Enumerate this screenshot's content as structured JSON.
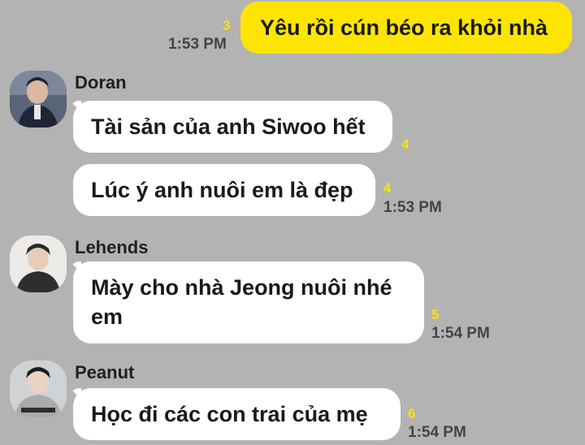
{
  "messages": {
    "me": {
      "text": "Yêu rồi cún béo ra khỏi nhà",
      "unread": "3",
      "time": "1:53 PM"
    },
    "doran": {
      "sender": "Doran",
      "bubble1": {
        "text": "Tài sản của anh Siwoo hết",
        "unread": "4"
      },
      "bubble2": {
        "text": "Lúc ý anh nuôi em là đẹp",
        "unread": "4",
        "time": "1:53 PM"
      }
    },
    "lehends": {
      "sender": "Lehends",
      "bubble1": {
        "line1": "Mày cho nhà Jeong nuôi nhé",
        "line2": "em",
        "unread": "5",
        "time": "1:54 PM"
      }
    },
    "peanut": {
      "sender": "Peanut",
      "bubble1": {
        "text": "Học đi các con trai của mẹ",
        "unread": "6",
        "time": "1:54 PM"
      }
    }
  },
  "colors": {
    "background": "#b3b3b3",
    "my_bubble": "#fee500",
    "other_bubble": "#ffffff",
    "unread_count": "#fee500"
  },
  "icons": {
    "doran_avatar": "avatar-photo",
    "lehends_avatar": "avatar-photo",
    "peanut_avatar": "avatar-photo"
  }
}
